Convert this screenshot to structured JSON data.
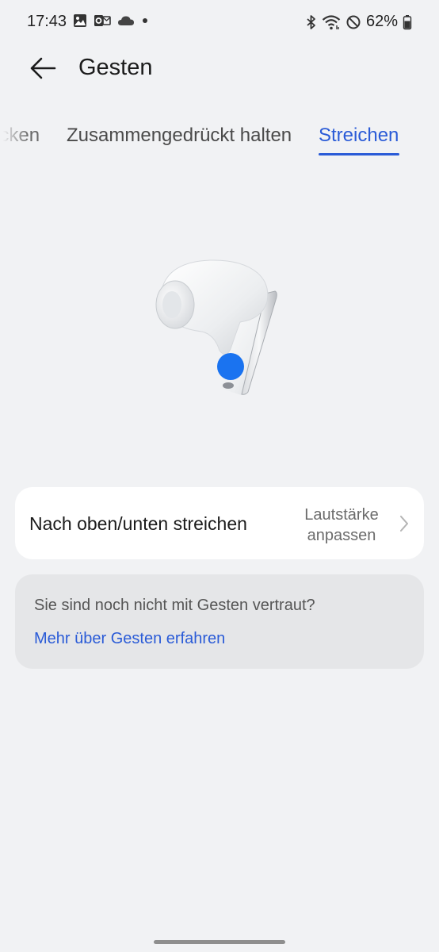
{
  "status_bar": {
    "time": "17:43",
    "battery_percent": "62%",
    "left_icons": [
      "gallery-icon",
      "outlook-icon",
      "cloud-icon",
      "dot-icon"
    ],
    "right_icons": [
      "bluetooth-icon",
      "wifi-icon",
      "do-not-disturb-icon",
      "battery-icon"
    ]
  },
  "header": {
    "title": "Gesten",
    "back_icon": "arrow-left-icon"
  },
  "tabs": [
    {
      "label": "Drücken",
      "visible_text": "ücken",
      "active": false
    },
    {
      "label": "Zusammengedrückt halten",
      "active": false
    },
    {
      "label": "Streichen",
      "active": true
    }
  ],
  "illustration": {
    "name": "earbud",
    "indicator_color": "#1a73f0"
  },
  "gesture": {
    "label": "Nach oben/unten streichen",
    "value_line1": "Lautstärke",
    "value_line2": "anpassen"
  },
  "info": {
    "text": "Sie sind noch nicht mit Gesten vertraut?",
    "link": "Mehr über Gesten erfahren"
  },
  "colors": {
    "accent": "#2a5bd7",
    "background": "#f1f2f4",
    "card": "#ffffff",
    "info_card": "#e5e6e8"
  }
}
